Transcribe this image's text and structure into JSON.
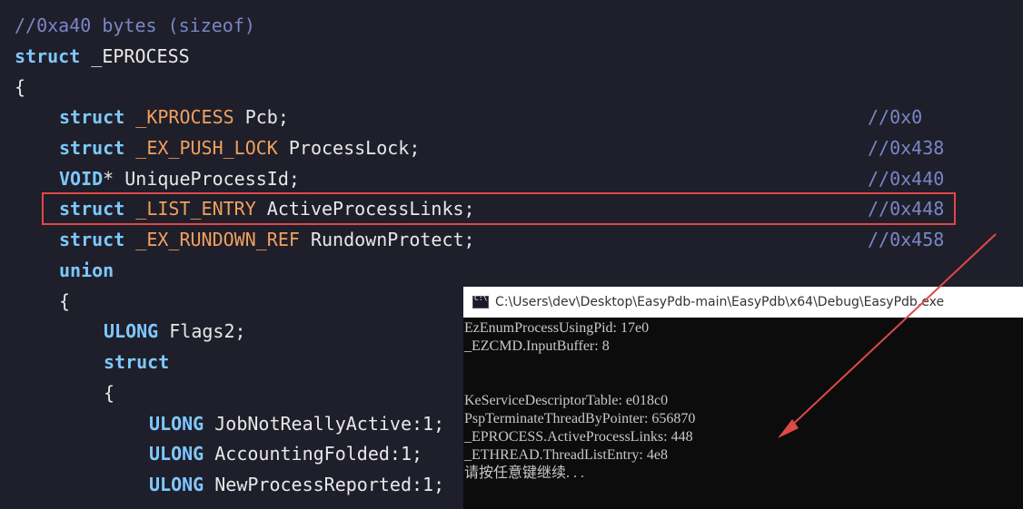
{
  "code": {
    "lines": [
      {
        "comment": "//0xa40 bytes (sizeof)"
      },
      {
        "kw": "struct",
        "name": " _EPROCESS"
      },
      {
        "text": "{"
      },
      {
        "kw": "struct",
        "type": " _KPROCESS",
        "member": " Pcb;",
        "offset": "//0x0"
      },
      {
        "kw": "struct",
        "type": " _EX_PUSH_LOCK",
        "member": " ProcessLock;",
        "offset": "//0x438"
      },
      {
        "kw": "VOID",
        "member": "* UniqueProcessId;",
        "offset": "//0x440"
      },
      {
        "kw": "struct",
        "type": " _LIST_ENTRY",
        "member": " ActiveProcessLinks;",
        "offset": "//0x448"
      },
      {
        "kw": "struct",
        "type": " _EX_RUNDOWN_REF",
        "member": " RundownProtect;",
        "offset": "//0x458"
      },
      {
        "kw": "union"
      },
      {
        "text": "{"
      },
      {
        "kw": "ULONG",
        "member": " Flags2;"
      },
      {
        "kw": "struct"
      },
      {
        "text": "{"
      },
      {
        "kw": "ULONG",
        "member": " JobNotReallyActive:1;"
      },
      {
        "kw": "ULONG",
        "member": " AccountingFolded:1;"
      },
      {
        "kw": "ULONG",
        "member": " NewProcessReported:1;"
      }
    ]
  },
  "console": {
    "title": "C:\\Users\\dev\\Desktop\\EasyPdb-main\\EasyPdb\\x64\\Debug\\EasyPdb.exe",
    "lines": [
      "EzEnumProcessUsingPid: 17e0",
      "_EZCMD.InputBuffer: 8",
      "",
      "",
      "KeServiceDescriptorTable: e018c0",
      "PspTerminateThreadByPointer: 656870",
      "_EPROCESS.ActiveProcessLinks: 448",
      "_ETHREAD.ThreadListEntry: 4e8",
      "请按任意键继续. . ."
    ]
  },
  "colors": {
    "background": "#1e1f2a",
    "keyword": "#7fc8ff",
    "type": "#f2a05e",
    "comment": "#7a86c8",
    "highlight": "#e04848",
    "console_bg": "#0c0c0c"
  }
}
